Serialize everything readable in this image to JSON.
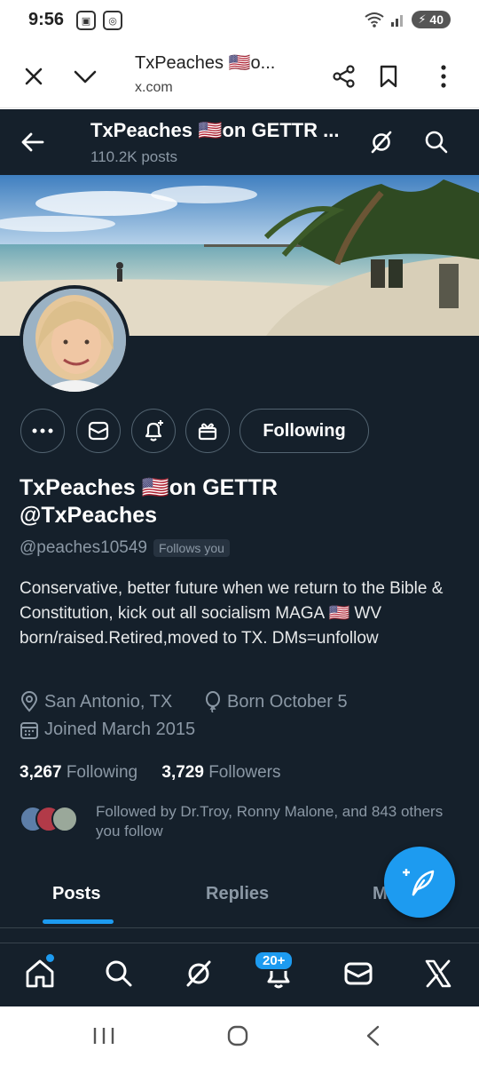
{
  "status_bar": {
    "time": "9:56",
    "battery": "40"
  },
  "browser": {
    "page_title": "TxPeaches 🇺🇸o...",
    "domain": "x.com"
  },
  "profile_header": {
    "title": "TxPeaches 🇺🇸on GETTR ...",
    "post_count": "110.2K posts"
  },
  "actions": {
    "following_label": "Following"
  },
  "profile": {
    "display_name_line1": "TxPeaches 🇺🇸on GETTR",
    "display_name_line2": "@TxPeaches",
    "handle": "@peaches10549",
    "follows_you": "Follows you",
    "bio": "Conservative, better future when we return to the Bible & Constitution, kick out all socialism MAGA 🇺🇸 WV born/raised.Retired,moved to TX. DMs=unfollow",
    "location": "San Antonio, TX",
    "birthday": "Born October 5",
    "joined": "Joined March 2015",
    "following_count": "3,267",
    "following_label": "Following",
    "followers_count": "3,729",
    "followers_label": "Followers",
    "followed_by": "Followed by Dr.Troy, Ronny Malone, and 843 others you follow"
  },
  "tabs": [
    {
      "label": "Posts",
      "active": true
    },
    {
      "label": "Replies",
      "active": false
    },
    {
      "label": "M",
      "active": false
    }
  ],
  "bottom_nav": {
    "notifications_badge": "20+"
  },
  "colors": {
    "background": "#15202b",
    "accent": "#1d9bf0",
    "muted": "#8b98a5"
  }
}
